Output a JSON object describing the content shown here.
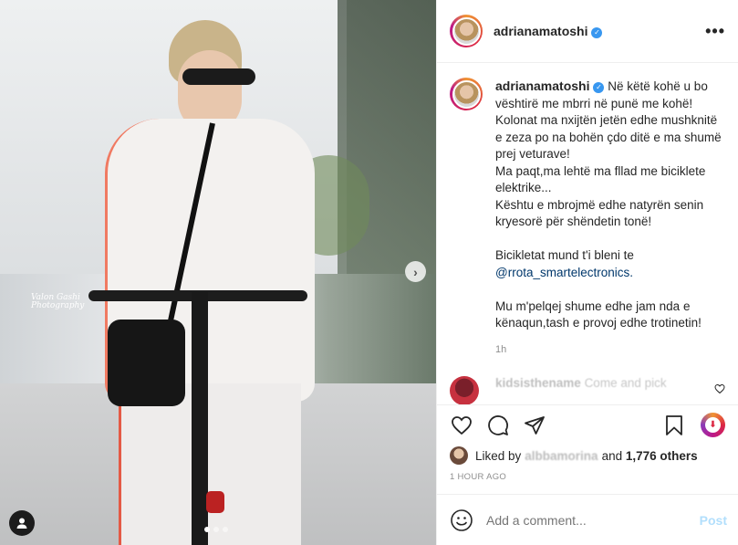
{
  "post": {
    "username": "adrianamatoshi",
    "verified": true,
    "watermark": {
      "line1": "Valon Gashi",
      "line2": "Photography"
    },
    "caption": "Në këtë kohë u bo vështirë me mbrri në punë me kohë!\nKolonat ma nxijtën jetën edhe mushknitë e zeza po na bohën çdo ditë e ma shumë prej veturave!\nMa paqt,ma lehtë ma fllad me biciklete elektrike...\nKështu e mbrojmë edhe natyrën senin kryesorë për shëndetin tonë!\n\nBicikletat mund t'i bleni te ",
    "caption_mention": "@rrota_smartelectronics.",
    "caption_tail": "\n\nMu m'pelqej shume edhe jam nda e kënaqun,tash e provoj edhe trotinetin!",
    "caption_time": "1h",
    "comment": {
      "username": "kidsisthename",
      "text": "Come and pick"
    },
    "likes": {
      "prefix": "Liked by",
      "user": "albbamorina",
      "joiner": "and",
      "others": "1,776 others"
    },
    "timestamp": "1 HOUR AGO",
    "add_comment_placeholder": "Add a comment...",
    "post_label": "Post"
  },
  "icons": {
    "more": "more-options-icon",
    "heart": "heart-icon",
    "comment": "comment-icon",
    "share": "share-icon",
    "bookmark": "bookmark-icon",
    "emoji": "emoji-icon",
    "tag": "user-tag-icon",
    "next": "chevron-right-icon"
  },
  "carousel": {
    "total": 3,
    "active": 1
  },
  "colors": {
    "verified": "#3897f0",
    "mention": "#00376b",
    "post_button": "#b2dffc"
  }
}
